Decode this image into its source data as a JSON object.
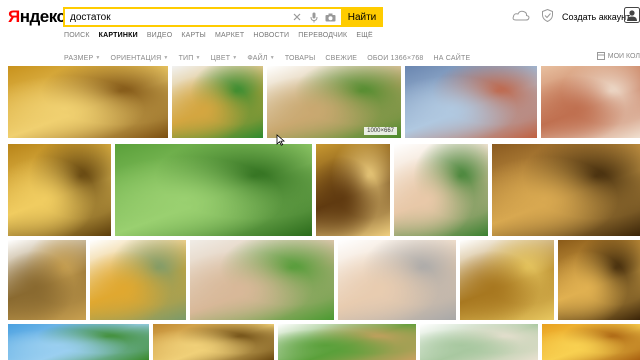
{
  "header": {
    "logo_ya": "Я",
    "logo_rest": "ндекс",
    "search_value": "достаток",
    "search_button": "Найти",
    "account_label": "Создать аккаунт"
  },
  "tabs": [
    {
      "label": "ПОИСК",
      "active": false
    },
    {
      "label": "КАРТИНКИ",
      "active": true
    },
    {
      "label": "ВИДЕО",
      "active": false
    },
    {
      "label": "КАРТЫ",
      "active": false
    },
    {
      "label": "МАРКЕТ",
      "active": false
    },
    {
      "label": "НОВОСТИ",
      "active": false
    },
    {
      "label": "ПЕРЕВОДЧИК",
      "active": false
    },
    {
      "label": "ЕЩЁ",
      "active": false
    }
  ],
  "filters": [
    {
      "label": "РАЗМЕР",
      "dropdown": true
    },
    {
      "label": "ОРИЕНТАЦИЯ",
      "dropdown": true
    },
    {
      "label": "ТИП",
      "dropdown": true
    },
    {
      "label": "ЦВЕТ",
      "dropdown": true
    },
    {
      "label": "ФАЙЛ",
      "dropdown": true
    },
    {
      "label": "ТОВАРЫ",
      "dropdown": false
    },
    {
      "label": "СВЕЖИЕ",
      "dropdown": false
    },
    {
      "label": "ОБОИ 1366×768",
      "dropdown": false
    },
    {
      "label": "НА САЙТЕ",
      "dropdown": false
    }
  ],
  "my_collections": "МОИ КОЛ",
  "hovered_image_size": "1000×667",
  "colors": {
    "accent": "#ffcc00",
    "logo_red": "#ff0000"
  },
  "images": [
    {
      "name": "gold-coins-feng-shui",
      "colors": [
        "#c8921c",
        "#f0d070",
        "#7a4e10"
      ]
    },
    {
      "name": "horseshoe-coins",
      "colors": [
        "#f2f2f2",
        "#d4a640",
        "#2e8a2e"
      ]
    },
    {
      "name": "hand-coins-plants",
      "colors": [
        "#ffffff",
        "#c9a870",
        "#4a8a2a"
      ]
    },
    {
      "name": "euro-banknotes",
      "colors": [
        "#6a86b0",
        "#b0c8e0",
        "#c06040"
      ]
    },
    {
      "name": "ruble-banknotes",
      "colors": [
        "#e8c0a0",
        "#c07050",
        "#f0e0d0"
      ]
    },
    {
      "name": "gold-coins-pile",
      "colors": [
        "#b88418",
        "#f0cc60",
        "#5a3c0a"
      ]
    },
    {
      "name": "dollars-grass",
      "colors": [
        "#5aa03a",
        "#9ad070",
        "#2a6a1a"
      ]
    },
    {
      "name": "treasure-chest",
      "colors": [
        "#c89830",
        "#603a10",
        "#f0d080"
      ]
    },
    {
      "name": "hands-money-tree",
      "colors": [
        "#ffffff",
        "#e8c8a8",
        "#3a8030"
      ]
    },
    {
      "name": "chest-of-gold",
      "colors": [
        "#8a5a20",
        "#d8a850",
        "#3a2408"
      ]
    },
    {
      "name": "money-toad",
      "colors": [
        "#ffffff",
        "#8a6a30",
        "#c8a050"
      ]
    },
    {
      "name": "golden-egg-nest",
      "colors": [
        "#ffffff",
        "#e0a830",
        "#7a9a6a"
      ]
    },
    {
      "name": "hands-sprout-coins",
      "colors": [
        "#f0ece6",
        "#d8b898",
        "#4a9a30"
      ]
    },
    {
      "name": "hand-coins-stack",
      "colors": [
        "#ffffff",
        "#e8ccb0",
        "#a8a8a8"
      ]
    },
    {
      "name": "toad-statue-gold",
      "colors": [
        "#ffffff",
        "#a87820",
        "#e8c860"
      ]
    },
    {
      "name": "gold-coins-close",
      "colors": [
        "#8a5a18",
        "#e0b050",
        "#3a2408"
      ]
    },
    {
      "name": "sky-tree",
      "colors": [
        "#4aa0e0",
        "#9acff0",
        "#3a8a2a"
      ]
    },
    {
      "name": "coins-stack-bottom",
      "colors": [
        "#c08830",
        "#f0d078",
        "#6a4810"
      ]
    },
    {
      "name": "plant-coins-bottom",
      "colors": [
        "#ffffff",
        "#5aa03a",
        "#c8a060"
      ]
    },
    {
      "name": "money-bills-fan",
      "colors": [
        "#ffffff",
        "#a8c8a0",
        "#e8e0d0"
      ]
    },
    {
      "name": "gold-bars",
      "colors": [
        "#e8a020",
        "#f8d050",
        "#a86010"
      ]
    },
    {
      "name": "wealth-poster",
      "colors": [
        "#c03020",
        "#f0b020",
        "#602010"
      ]
    }
  ]
}
